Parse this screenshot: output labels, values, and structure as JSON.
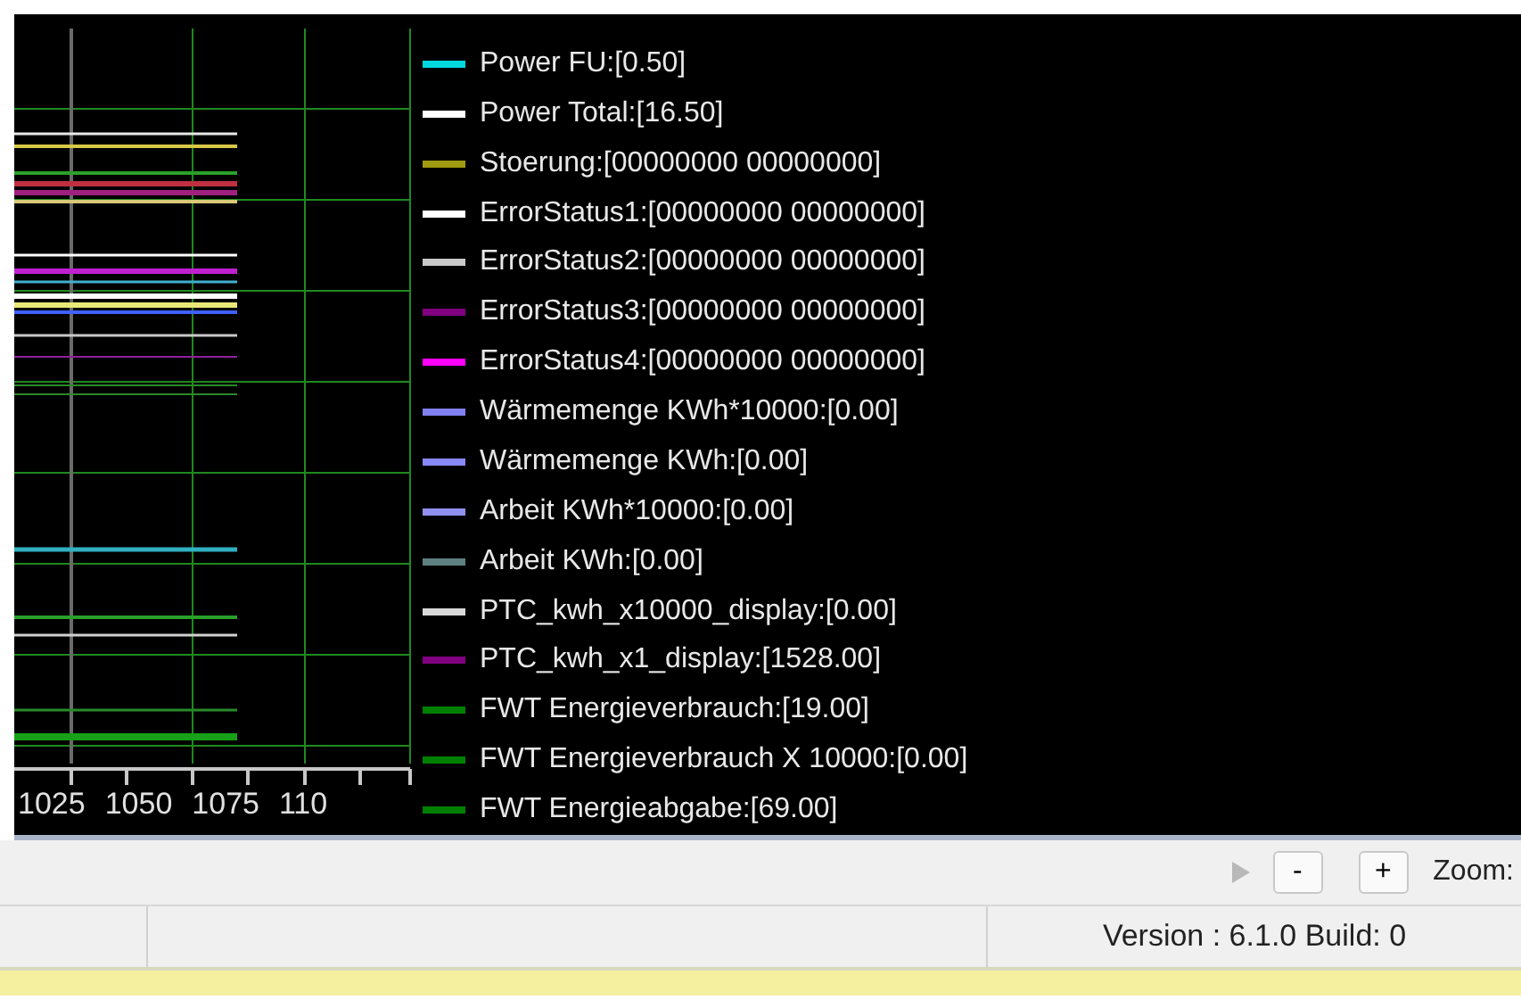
{
  "chart": {
    "x_tick_labels": [
      "1025",
      "1050",
      "1075",
      "110"
    ]
  },
  "legend": [
    {
      "label": "Power FU:[0.50]",
      "color": "#00d8e0"
    },
    {
      "label": "Power Total:[16.50]",
      "color": "#ffffff"
    },
    {
      "label": "Stoerung:[00000000 00000000]",
      "color": "#a09a10"
    },
    {
      "label": "ErrorStatus1:[00000000 00000000]",
      "color": "#ffffff"
    },
    {
      "label": "ErrorStatus2:[00000000 00000000]",
      "color": "#c8c8c8"
    },
    {
      "label": "ErrorStatus3:[00000000 00000000]",
      "color": "#800080"
    },
    {
      "label": "ErrorStatus4:[00000000 00000000]",
      "color": "#ff00ff"
    },
    {
      "label": "Wärmemenge KWh*10000:[0.00]",
      "color": "#8080f0"
    },
    {
      "label": "Wärmemenge KWh:[0.00]",
      "color": "#8888f8"
    },
    {
      "label": "Arbeit KWh*10000:[0.00]",
      "color": "#9090f0"
    },
    {
      "label": "Arbeit KWh:[0.00]",
      "color": "#5f8080"
    },
    {
      "label": "PTC_kwh_x10000_display:[0.00]",
      "color": "#d8d8d8"
    },
    {
      "label": "PTC_kwh_x1_display:[1528.00]",
      "color": "#800080"
    },
    {
      "label": "FWT Energieverbrauch:[19.00]",
      "color": "#008000"
    },
    {
      "label": "FWT Energieverbrauch X 10000:[0.00]",
      "color": "#008000"
    },
    {
      "label": "FWT Energieabgabe:[69.00]",
      "color": "#008000"
    }
  ],
  "toolbar": {
    "minus": "-",
    "plus": "+",
    "zoom_label": "Zoom:"
  },
  "status_bar": {
    "version": "Version : 6.1.0 Build: 0"
  }
}
